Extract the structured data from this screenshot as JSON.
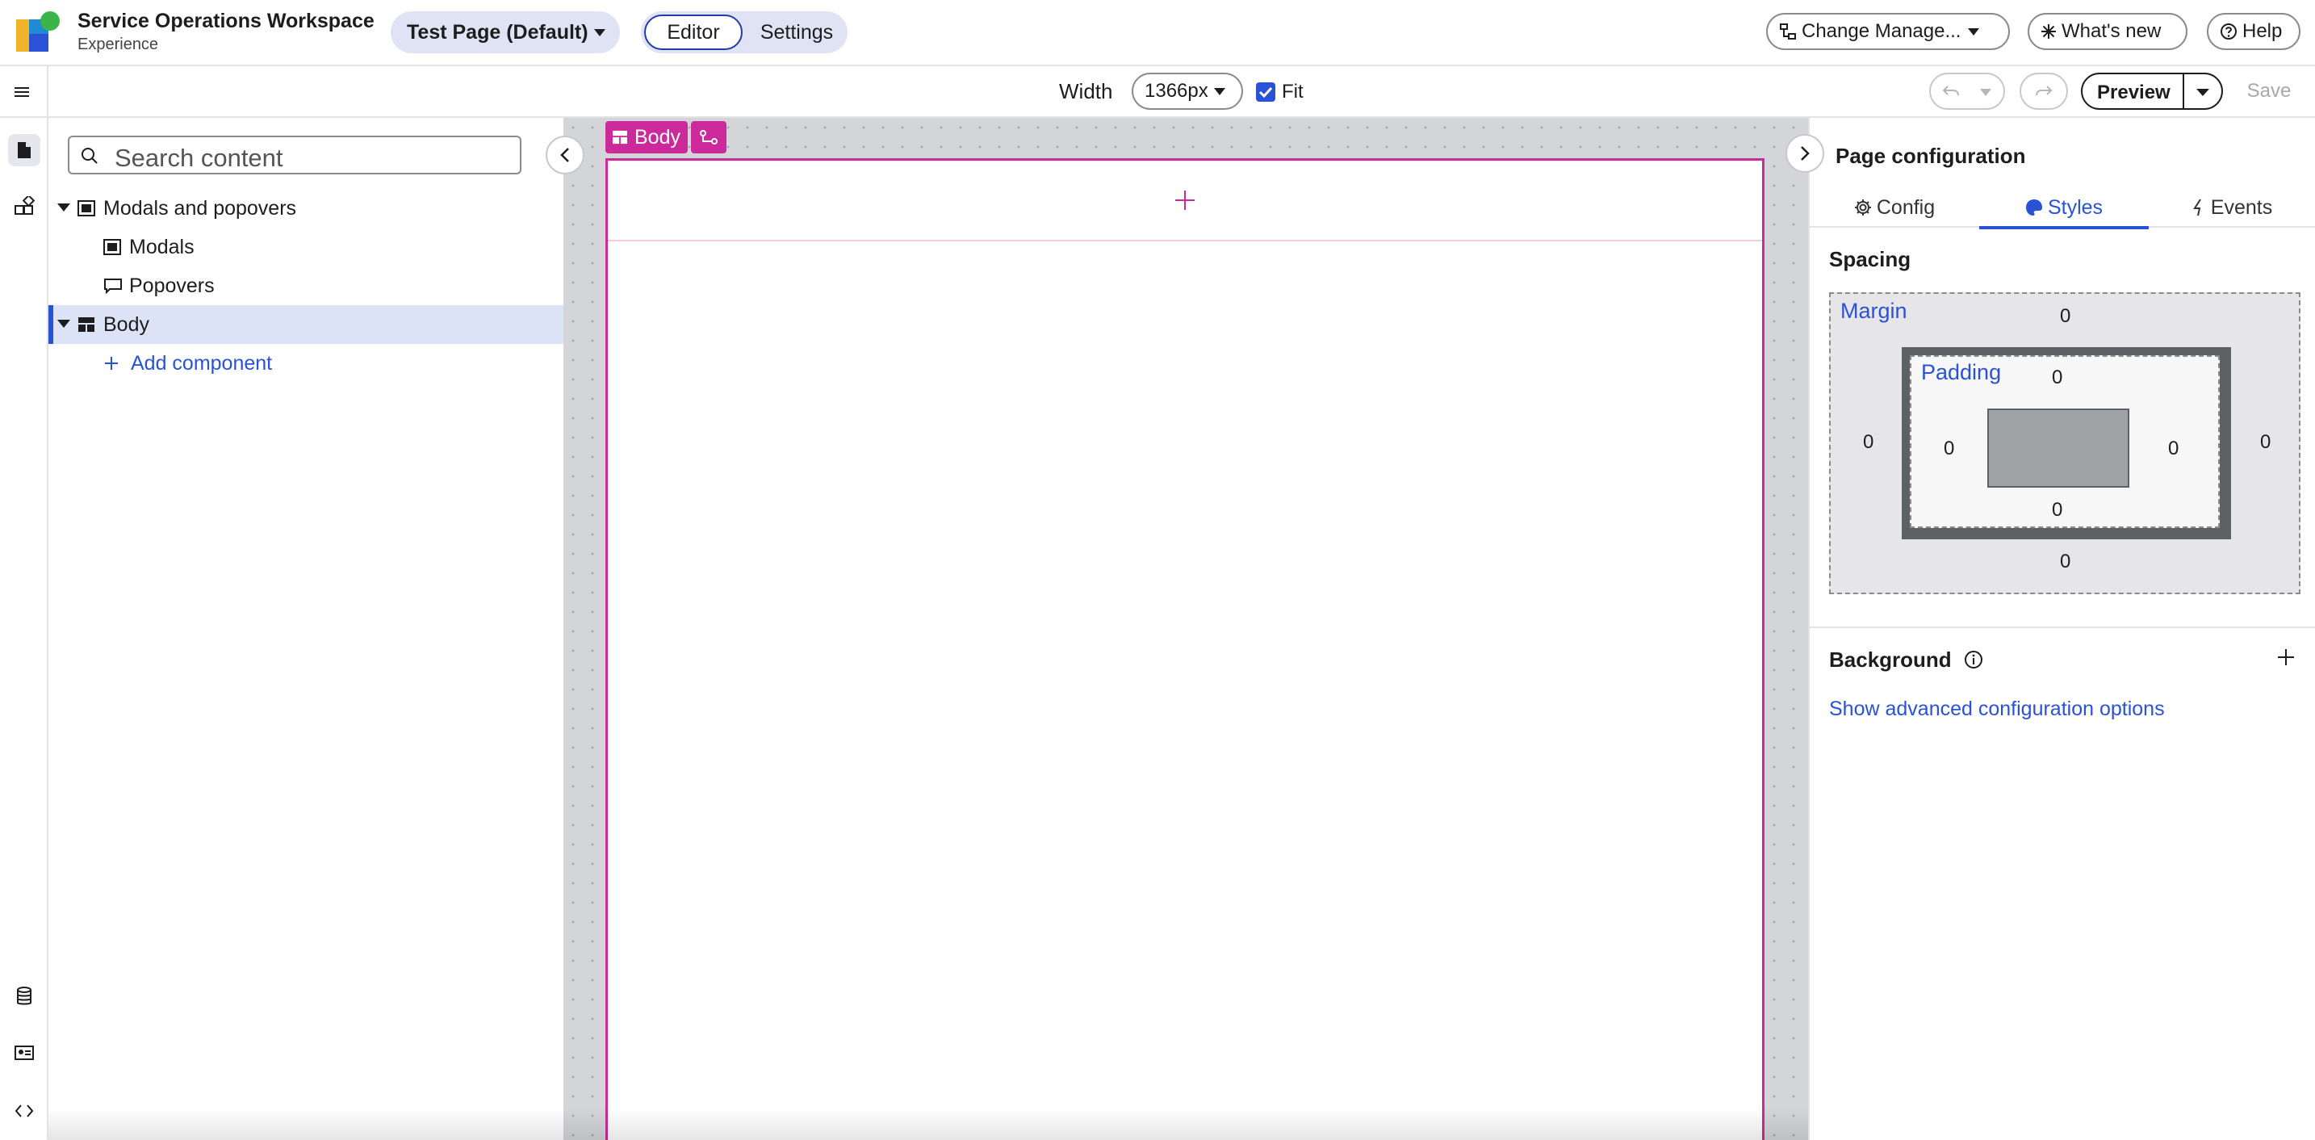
{
  "header": {
    "app_title": "Service Operations Workspace",
    "app_subtitle": "Experience",
    "page_selector": "Test Page (Default)",
    "modes": {
      "editor": "Editor",
      "settings": "Settings",
      "active": "Editor"
    },
    "change_manager": "Change Manage...",
    "whats_new": "What's new",
    "help": "Help"
  },
  "toolbar": {
    "width_label": "Width",
    "width_value": "1366px",
    "fit_label": "Fit",
    "fit_checked": true,
    "preview_label": "Preview",
    "save_label": "Save"
  },
  "left_panel": {
    "search_placeholder": "Search content",
    "tree": [
      {
        "label": "Modals and popovers",
        "icon": "modal-icon",
        "expanded": true
      },
      {
        "label": "Modals",
        "icon": "modal-icon"
      },
      {
        "label": "Popovers",
        "icon": "popover-icon"
      },
      {
        "label": "Body",
        "icon": "layout-icon",
        "expanded": true,
        "selected": true
      },
      {
        "label": "Add component",
        "icon": "plus-icon"
      }
    ]
  },
  "canvas": {
    "selected_chip": "Body"
  },
  "right_panel": {
    "title": "Page configuration",
    "tabs": [
      {
        "label": "Config",
        "icon": "gear-icon"
      },
      {
        "label": "Styles",
        "icon": "palette-icon",
        "active": true
      },
      {
        "label": "Events",
        "icon": "lightning-icon"
      }
    ],
    "spacing": {
      "heading": "Spacing",
      "margin_label": "Margin",
      "padding_label": "Padding",
      "margin": {
        "top": "0",
        "right": "0",
        "bottom": "0",
        "left": "0"
      },
      "padding": {
        "top": "0",
        "right": "0",
        "bottom": "0",
        "left": "0"
      }
    },
    "background_heading": "Background",
    "advanced_link": "Show advanced configuration options"
  },
  "colors": {
    "accent": "#2a52d6",
    "canvas_highlight": "#cc2a9a",
    "selected_row": "#dce3f7",
    "mode_toggle_bg": "#dfe3f4"
  }
}
